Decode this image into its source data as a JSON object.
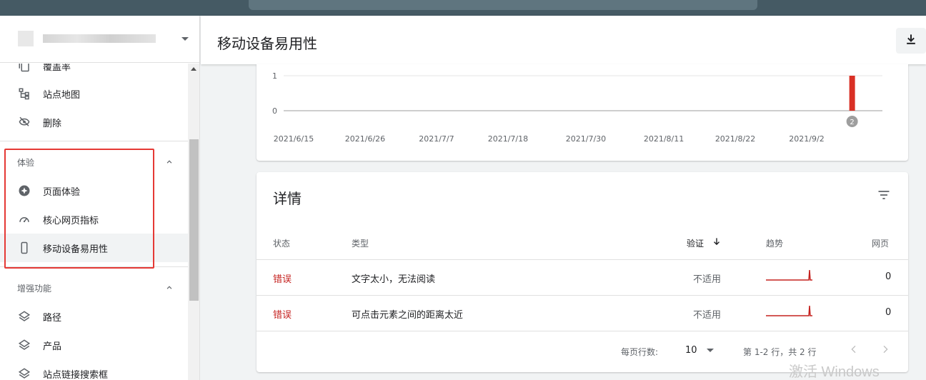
{
  "sidebar": {
    "items_top": [
      {
        "label": "覆盖率",
        "icon": "copy-icon"
      },
      {
        "label": "站点地图",
        "icon": "sitemap-icon"
      },
      {
        "label": "删除",
        "icon": "eye-off-icon"
      }
    ],
    "section_experience": "体验",
    "experience_items": [
      {
        "label": "页面体验",
        "icon": "star-circle-icon"
      },
      {
        "label": "核心网页指标",
        "icon": "speedometer-icon"
      },
      {
        "label": "移动设备易用性",
        "icon": "smartphone-icon"
      }
    ],
    "section_enhancements": "增强功能",
    "enhancement_items": [
      {
        "label": "路径",
        "icon": "layers-icon"
      },
      {
        "label": "产品",
        "icon": "layers-icon"
      },
      {
        "label": "站点链接搜索框",
        "icon": "layers-icon"
      }
    ],
    "highlight_color": "#e53935"
  },
  "header": {
    "title": "移动设备易用性",
    "download_icon": "download-icon"
  },
  "chart_data": {
    "type": "bar",
    "y_ticks": [
      "1",
      "0"
    ],
    "x_tick_labels": [
      "2021/6/15",
      "2021/6/26",
      "2021/7/7",
      "2021/7/18",
      "2021/7/30",
      "2021/8/11",
      "2021/8/22",
      "2021/9/2"
    ],
    "ylim": [
      0,
      1
    ],
    "bars": [
      {
        "date": "2021/9/9",
        "value": 1
      }
    ],
    "annotation": "2",
    "bar_color": "#d93025"
  },
  "details": {
    "title": "详情",
    "columns": {
      "status": "状态",
      "type": "类型",
      "validation": "验证",
      "trend": "趋势",
      "pages": "网页"
    },
    "rows": [
      {
        "status": "错误",
        "type": "文字太小，无法阅读",
        "validation": "不适用",
        "pages": "0"
      },
      {
        "status": "错误",
        "type": "可点击元素之间的距离太近",
        "validation": "不适用",
        "pages": "0"
      }
    ],
    "footer": {
      "rows_per_page_label": "每页行数:",
      "rows_per_page_value": "10",
      "range": "第 1-2 行，共 2 行"
    }
  },
  "watermark": "激活 Windows"
}
